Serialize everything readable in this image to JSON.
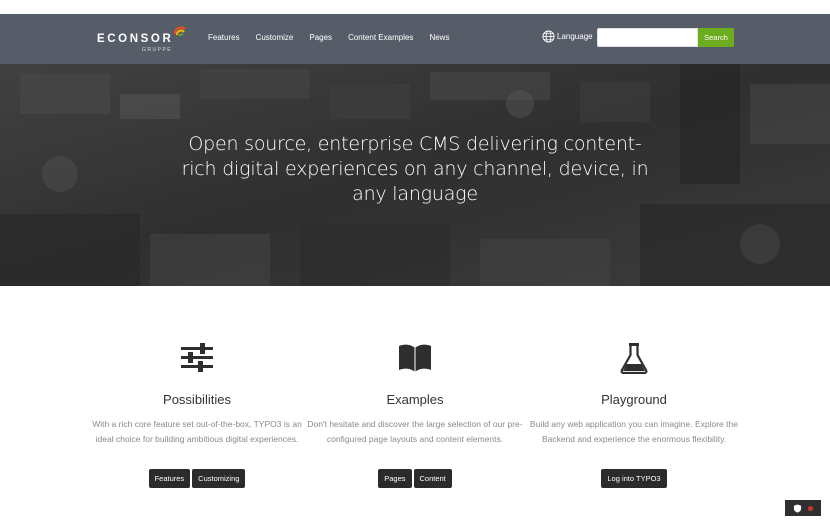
{
  "header": {
    "logo": {
      "name": "ECONSOR",
      "sub": "GRUPPE"
    },
    "nav": [
      "Features",
      "Customize",
      "Pages",
      "Content Examples",
      "News"
    ],
    "language_label": "Language",
    "search": {
      "value": "",
      "placeholder": "",
      "button_label": "Search"
    }
  },
  "hero": {
    "title": "Open source, enterprise CMS delivering content-rich digital experiences on any channel, device, in any language"
  },
  "features": [
    {
      "icon": "sliders-icon",
      "title": "Possibilities",
      "text": "With a rich core feature set out-of-the-box, TYPO3 is an ideal choice for building ambitious digital experiences.",
      "buttons": [
        "Features",
        "Customizing"
      ]
    },
    {
      "icon": "book-icon",
      "title": "Examples",
      "text": "Don't hesitate and discover the large selection of our pre-configured page layouts and content elements.",
      "buttons": [
        "Pages",
        "Content"
      ]
    },
    {
      "icon": "flask-icon",
      "title": "Playground",
      "text": "Build any web application you can imagine. Explore the Backend and experience the enormous flexibility.",
      "buttons": [
        "Log into TYPO3"
      ]
    }
  ],
  "colors": {
    "navbar": "#575d68",
    "search_button": "#6cad1f",
    "button_dark": "#2b2b2b"
  }
}
